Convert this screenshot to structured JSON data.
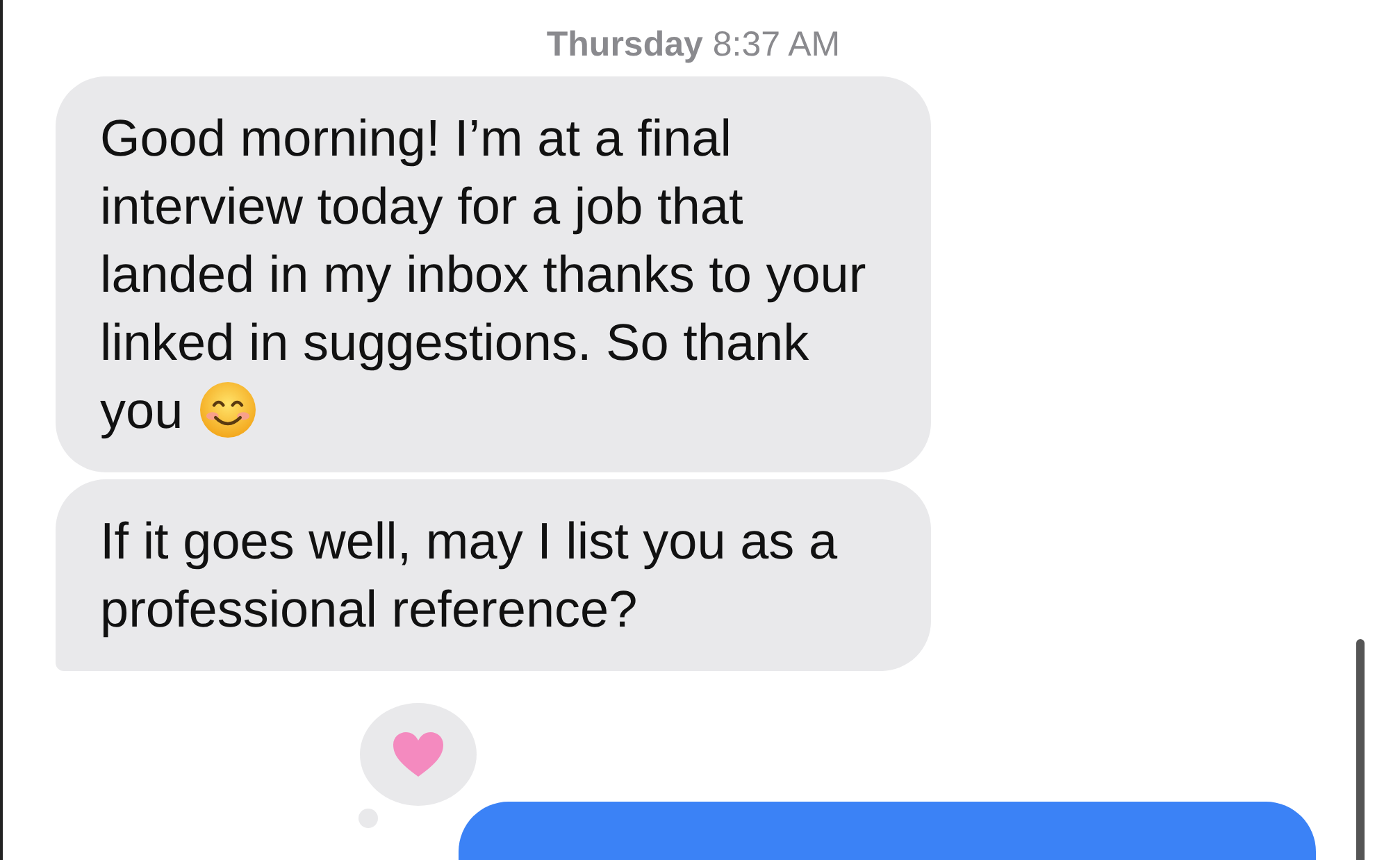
{
  "timestamp": {
    "day": "Thursday",
    "time": "8:37 AM"
  },
  "messages": [
    {
      "kind": "received",
      "text": "Good morning! I’m at a final interview today for a job that landed in my inbox thanks to your linked in suggestions. So thank you",
      "emoji": true,
      "tail": false
    },
    {
      "kind": "received",
      "text": "If it goes well, may I list you as a professional reference?",
      "emoji": false,
      "tail": true
    },
    {
      "kind": "sent",
      "reaction": {
        "kind": "heart"
      }
    }
  ]
}
